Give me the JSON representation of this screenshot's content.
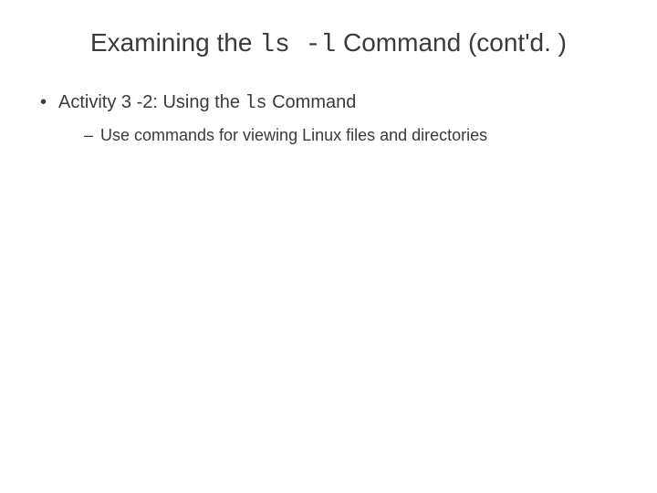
{
  "title": {
    "prefix": "Examining the ",
    "code": "ls -l",
    "suffix": " Command (cont'd. )"
  },
  "bullets": [
    {
      "prefix": "Activity 3 -2: Using the ",
      "code": "ls",
      "suffix": " Command",
      "sub": [
        "Use commands for viewing Linux files and directories"
      ]
    }
  ]
}
